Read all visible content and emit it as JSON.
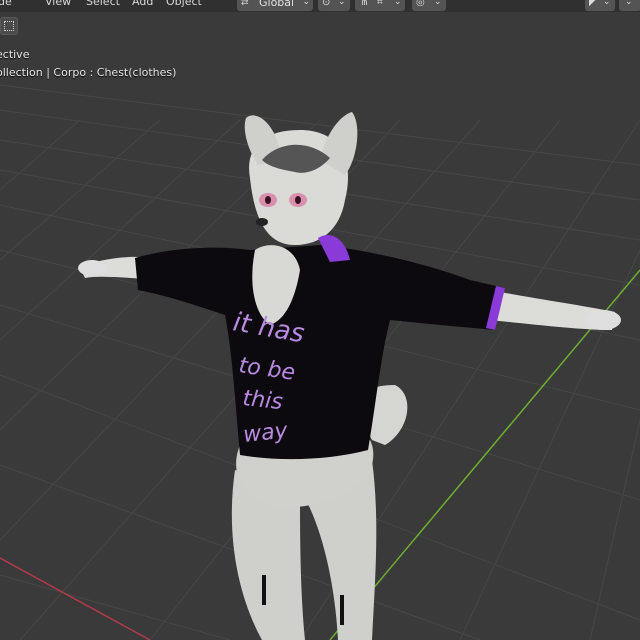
{
  "menu": {
    "mode_fragment": "de",
    "view": "View",
    "select": "Select",
    "add": "Add",
    "object": "Object"
  },
  "header": {
    "transform_orientation": "Global"
  },
  "overlay": {
    "view_label": "ective",
    "collection_path": "ollection | Corpo : Chest(clothes)"
  },
  "shirt_text": {
    "line1": "it has",
    "line2": "to be",
    "line3": "this",
    "line4": "way"
  },
  "colors": {
    "viewport_bg": "#3a3a3a",
    "grid_line": "#4a4a4a",
    "axis_y": "#6fae2f",
    "axis_x": "#b03a4a",
    "shirt": "#0c0a0e",
    "shirt_accent": "#8a3ad6",
    "shirt_text": "#b98ae0",
    "fur": "#d9d9d6"
  },
  "icons": {
    "snap": "magnet-icon",
    "pivot": "pivot-icon",
    "proportional": "proportional-editing-icon",
    "overlays": "overlays-icon",
    "shading": "shading-icon",
    "select_box": "select-box-icon"
  }
}
